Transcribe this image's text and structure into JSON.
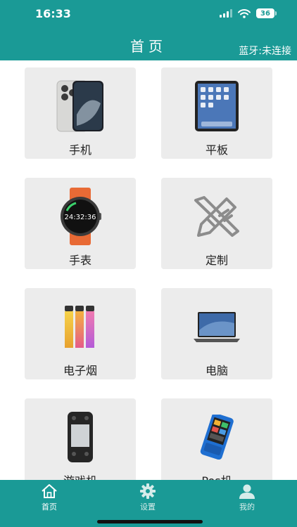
{
  "status_bar": {
    "time": "16:33",
    "battery": "36"
  },
  "header": {
    "title": "首页",
    "bluetooth_status": "蓝牙:未连接"
  },
  "categories": [
    {
      "label": "手机",
      "icon": "smartphone-icon"
    },
    {
      "label": "平板",
      "icon": "tablet-icon"
    },
    {
      "label": "手表",
      "icon": "smartwatch-icon",
      "watch_time": "24:32:36"
    },
    {
      "label": "定制",
      "icon": "pencil-ruler-icon"
    },
    {
      "label": "电子烟",
      "icon": "e-cigarette-icon"
    },
    {
      "label": "电脑",
      "icon": "laptop-icon"
    },
    {
      "label": "游戏机",
      "icon": "game-console-icon"
    },
    {
      "label": "Pos机",
      "icon": "pos-terminal-icon"
    }
  ],
  "tabs": [
    {
      "label": "首页",
      "icon": "home-icon",
      "active": true
    },
    {
      "label": "设置",
      "icon": "gear-icon",
      "active": false
    },
    {
      "label": "我的",
      "icon": "user-icon",
      "active": false
    }
  ],
  "colors": {
    "brand": "#1a9a96",
    "card": "#ececec"
  }
}
